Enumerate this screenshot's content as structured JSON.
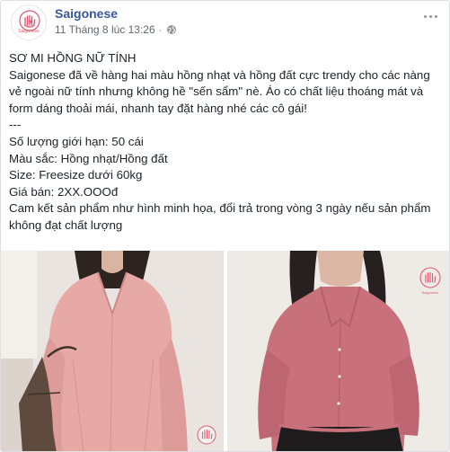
{
  "post": {
    "page_name": "Saigonese",
    "timestamp": "11 Tháng 8 lúc 13:26",
    "separator": "·",
    "avatar_logo_text": "Saigonese",
    "icons": {
      "avatar": "hand-heart-logo",
      "privacy": "globe-icon",
      "more": "more-options-icon"
    },
    "lines": [
      "SƠ MI HỒNG NỮ TÍNH",
      "Saigonese đã về hàng hai màu hồng nhạt và hồng đất cực trendy cho các nàng vẻ ngoài nữ tính nhưng không hề \"sến sẩm\" nè. Áo có chất liệu thoáng mát và form dáng thoải mái, nhanh tay đặt hàng nhé các cô gái!",
      "---",
      "Số lượng giới hạn: 50 cái",
      "Màu sắc: Hồng nhạt/Hồng đất",
      "Size: Freesize dưới 60kg",
      "Giá bán: 2XX.OOOđ",
      "Cam kết sản phẩm như hình minh họa, đổi trả trong vòng 3 ngày nếu sản phẩm không đạt chất lượng"
    ],
    "photo_watermark_text": "Saigonese",
    "colors": {
      "link": "#385898",
      "text": "#1d2129",
      "meta": "#616770",
      "light_pink_shirt": "#e7a9a6",
      "earth_pink_shirt": "#c9717b",
      "logo": "#e15a6f"
    }
  }
}
